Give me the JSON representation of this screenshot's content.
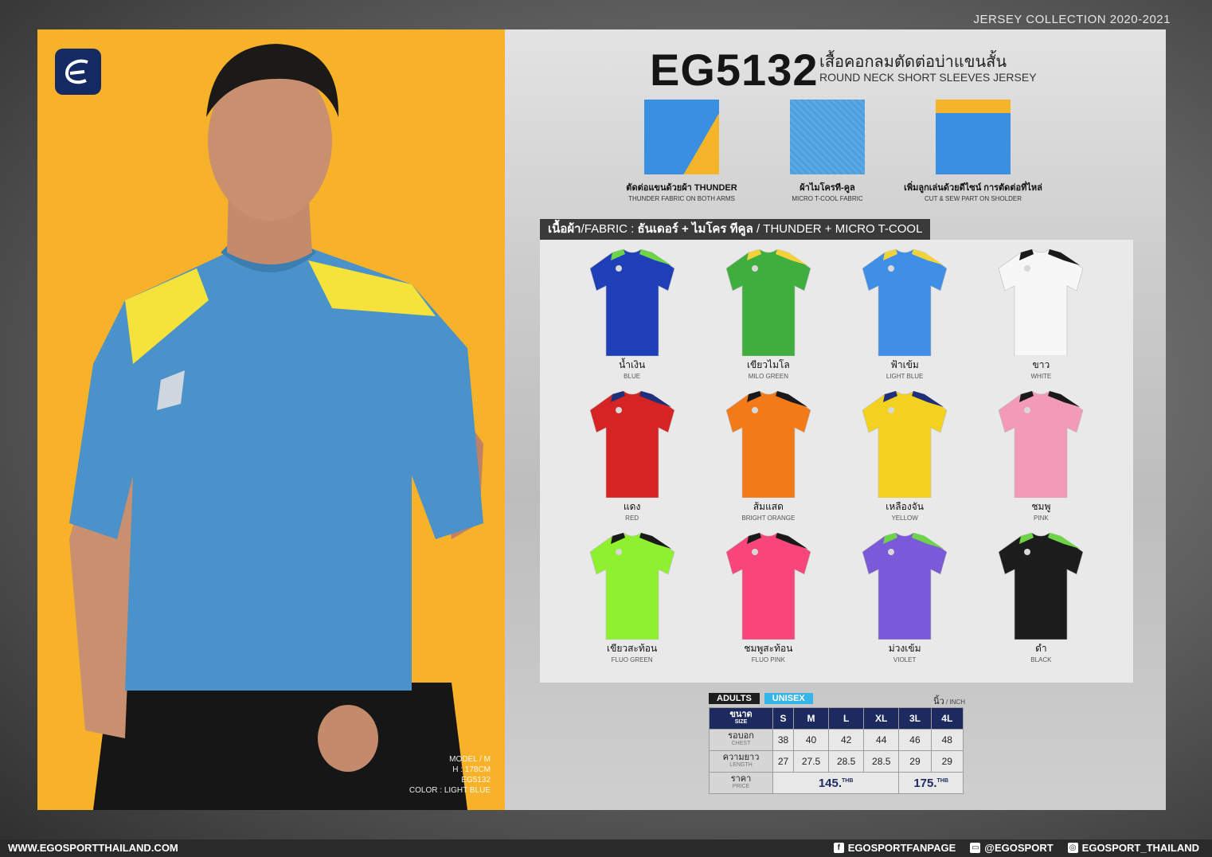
{
  "header": {
    "collection": "JERSEY COLLECTION 2020-2021"
  },
  "model": {
    "info": [
      "MODEL / M",
      "H : 178CM",
      "EG5132",
      "COLOR : LIGHT BLUE"
    ],
    "shirt_color": "#4a92c9",
    "accent_color": "#f5e23a",
    "shorts_color": "#161616",
    "background_color": "#f8b229"
  },
  "product": {
    "code": "EG5132",
    "name_th": "เสื้อคอกลมตัดต่อบ่าแขนสั้น",
    "name_en": "ROUND NECK SHORT SLEEVES JERSEY"
  },
  "features": [
    {
      "th": "ตัดต่อแขนด้วยผ้า THUNDER",
      "en": "THUNDER FABRIC ON BOTH ARMS"
    },
    {
      "th": "ผ้าไมโครที-คูล",
      "en": "MICRO T-COOL FABRIC"
    },
    {
      "th": "เพิ่มลูกเล่นด้วยดีไซน์ การตัดต่อที่ไหล่",
      "en": "CUT & SEW PART ON SHOLDER"
    }
  ],
  "fabric": {
    "label_th": "เนื้อผ้า",
    "label_en": "/FABRIC : ",
    "value_th": "ธันเดอร์ + ไมโคร ทีคูล",
    "value_en": " / THUNDER + MICRO T-COOL"
  },
  "colors": [
    {
      "th": "น้ำเงิน",
      "en": "BLUE",
      "body": "#1f3fb8",
      "accent": "#6fd34a"
    },
    {
      "th": "เขียวไมโล",
      "en": "MILO GREEN",
      "body": "#3fae3f",
      "accent": "#f2d23a"
    },
    {
      "th": "ฟ้าเข้ม",
      "en": "LIGHT BLUE",
      "body": "#3f8fe6",
      "accent": "#f2d23a"
    },
    {
      "th": "ขาว",
      "en": "WHITE",
      "body": "#f7f7f7",
      "accent": "#1a1a1a"
    },
    {
      "th": "แดง",
      "en": "RED",
      "body": "#d62424",
      "accent": "#1f2f7a"
    },
    {
      "th": "ส้มแสด",
      "en": "BRIGHT ORANGE",
      "body": "#f27a18",
      "accent": "#1a1a1a"
    },
    {
      "th": "เหลืองจัน",
      "en": "YELLOW",
      "body": "#f2d21e",
      "accent": "#1f2f7a"
    },
    {
      "th": "ชมพู",
      "en": "PINK",
      "body": "#f29ab8",
      "accent": "#1a1a1a"
    },
    {
      "th": "เขียวสะท้อน",
      "en": "FLUO GREEN",
      "body": "#8ef02e",
      "accent": "#1a1a1a"
    },
    {
      "th": "ชมพูสะท้อน",
      "en": "FLUO PINK",
      "body": "#f8467a",
      "accent": "#1a1a1a"
    },
    {
      "th": "ม่วงเข้ม",
      "en": "VIOLET",
      "body": "#7a5ad8",
      "accent": "#6fd34a"
    },
    {
      "th": "ดำ",
      "en": "BLACK",
      "body": "#1c1c1c",
      "accent": "#6fd34a"
    }
  ],
  "size_table": {
    "tag_adults": "ADULTS",
    "tag_unisex": "UNISEX",
    "unit_th": "นิ้ว",
    "unit_en": " / INCH",
    "header": {
      "th": "ขนาด",
      "en": "SIZE"
    },
    "sizes": [
      "S",
      "M",
      "L",
      "XL",
      "3L",
      "4L"
    ],
    "rows": [
      {
        "th": "รอบอก",
        "en": "CHEST",
        "values": [
          "38",
          "40",
          "42",
          "44",
          "46",
          "48"
        ]
      },
      {
        "th": "ความยาว",
        "en": "LENGTH",
        "values": [
          "27",
          "27.5",
          "28.5",
          "28.5",
          "29",
          "29"
        ]
      }
    ],
    "price": {
      "th": "ราคา",
      "en": "PRICE",
      "value_a": "145.",
      "value_b": "175.",
      "currency": "THB"
    }
  },
  "footer": {
    "website": "WWW.EGOSPORTTHAILAND.COM",
    "facebook": "EGOSPORTFANPAGE",
    "line": "@EGOSPORT",
    "instagram": "EGOSPORT_THAILAND"
  }
}
